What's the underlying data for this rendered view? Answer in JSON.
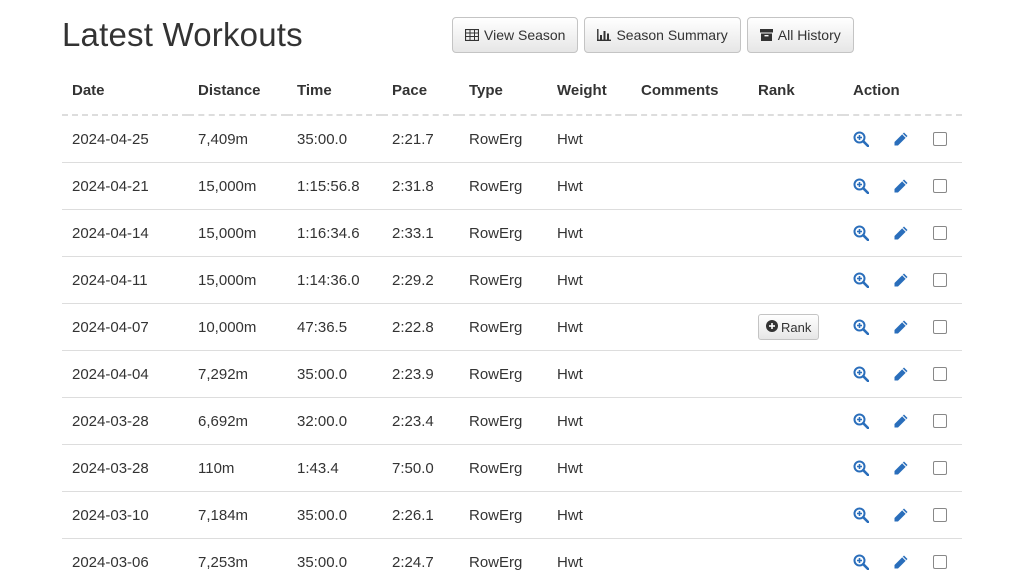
{
  "page": {
    "title": "Latest Workouts"
  },
  "toolbar": {
    "view_season_label": "View Season",
    "season_summary_label": "Season Summary",
    "all_history_label": "All History"
  },
  "table": {
    "headers": {
      "date": "Date",
      "distance": "Distance",
      "time": "Time",
      "pace": "Pace",
      "type": "Type",
      "weight": "Weight",
      "comments": "Comments",
      "rank": "Rank",
      "action": "Action"
    },
    "rows": [
      {
        "date": "2024-04-25",
        "distance": "7,409m",
        "time": "35:00.0",
        "pace": "2:21.7",
        "type": "RowErg",
        "weight": "Hwt",
        "comments": "",
        "rank": ""
      },
      {
        "date": "2024-04-21",
        "distance": "15,000m",
        "time": "1:15:56.8",
        "pace": "2:31.8",
        "type": "RowErg",
        "weight": "Hwt",
        "comments": "",
        "rank": ""
      },
      {
        "date": "2024-04-14",
        "distance": "15,000m",
        "time": "1:16:34.6",
        "pace": "2:33.1",
        "type": "RowErg",
        "weight": "Hwt",
        "comments": "",
        "rank": ""
      },
      {
        "date": "2024-04-11",
        "distance": "15,000m",
        "time": "1:14:36.0",
        "pace": "2:29.2",
        "type": "RowErg",
        "weight": "Hwt",
        "comments": "",
        "rank": ""
      },
      {
        "date": "2024-04-07",
        "distance": "10,000m",
        "time": "47:36.5",
        "pace": "2:22.8",
        "type": "RowErg",
        "weight": "Hwt",
        "comments": "",
        "rank": "Rank"
      },
      {
        "date": "2024-04-04",
        "distance": "7,292m",
        "time": "35:00.0",
        "pace": "2:23.9",
        "type": "RowErg",
        "weight": "Hwt",
        "comments": "",
        "rank": ""
      },
      {
        "date": "2024-03-28",
        "distance": "6,692m",
        "time": "32:00.0",
        "pace": "2:23.4",
        "type": "RowErg",
        "weight": "Hwt",
        "comments": "",
        "rank": ""
      },
      {
        "date": "2024-03-28",
        "distance": "110m",
        "time": "1:43.4",
        "pace": "7:50.0",
        "type": "RowErg",
        "weight": "Hwt",
        "comments": "",
        "rank": ""
      },
      {
        "date": "2024-03-10",
        "distance": "7,184m",
        "time": "35:00.0",
        "pace": "2:26.1",
        "type": "RowErg",
        "weight": "Hwt",
        "comments": "",
        "rank": ""
      },
      {
        "date": "2024-03-06",
        "distance": "7,253m",
        "time": "35:00.0",
        "pace": "2:24.7",
        "type": "RowErg",
        "weight": "Hwt",
        "comments": "",
        "rank": ""
      }
    ]
  },
  "icons": {
    "view_season": "table-grid-icon",
    "season_summary": "bar-chart-icon",
    "all_history": "archive-box-icon",
    "rank": "plus-circle-icon",
    "view_workout": "zoom-in-icon",
    "edit_workout": "pencil-icon",
    "select_row": "checkbox"
  },
  "colors": {
    "text": "#333333",
    "action_icon": "#2a6ebb",
    "border": "#dddddd",
    "button_border": "#c4c4c4"
  }
}
